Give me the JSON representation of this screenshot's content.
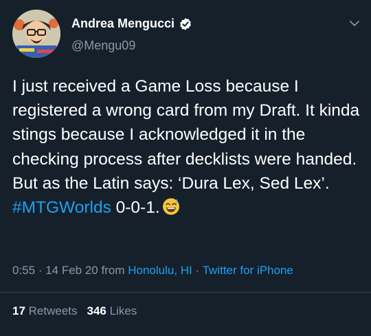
{
  "author": {
    "display_name": "Andrea Mengucci",
    "handle": "@Mengu09",
    "verified": true,
    "avatar_icon": "cartoon-portrait-avatar"
  },
  "tweet": {
    "text_before_hashtag": "I just received a Game Loss because I registered a wrong card from my Draft. It kinda stings because I acknowledged it in the checking process after decklists were handed. But as the Latin says: ‘Dura Lex, Sed Lex’. ",
    "hashtag": "#MTGWorlds",
    "text_after_hashtag": " 0-0-1.",
    "emoji": "grinning-face-with-sweat-emoji"
  },
  "meta": {
    "time": "0:55",
    "sep1": " · ",
    "date": "14 Feb 20",
    "from_label": " from ",
    "location": "Honolulu, HI",
    "sep2": " · ",
    "source": "Twitter for iPhone"
  },
  "stats": {
    "retweets_count": "17",
    "retweets_label": " Retweets",
    "likes_count": "346",
    "likes_label": " Likes"
  },
  "colors": {
    "background": "#15202b",
    "text": "#ffffff",
    "secondary": "#8899a6",
    "accent": "#1da1f2",
    "divider": "#38444d"
  }
}
